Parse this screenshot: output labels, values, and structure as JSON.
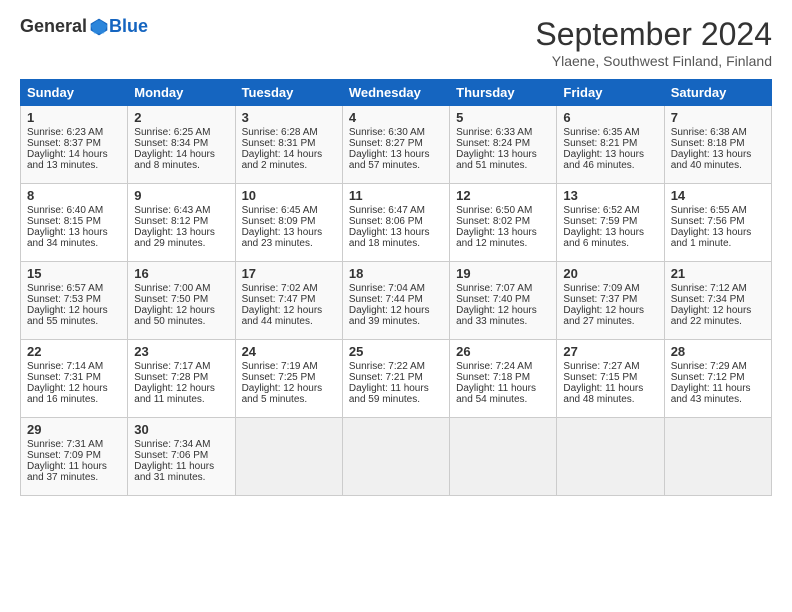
{
  "header": {
    "logo_general": "General",
    "logo_blue": "Blue",
    "title": "September 2024",
    "location": "Ylaene, Southwest Finland, Finland"
  },
  "days_of_week": [
    "Sunday",
    "Monday",
    "Tuesday",
    "Wednesday",
    "Thursday",
    "Friday",
    "Saturday"
  ],
  "weeks": [
    [
      {
        "day": "1",
        "sunrise": "Sunrise: 6:23 AM",
        "sunset": "Sunset: 8:37 PM",
        "daylight": "Daylight: 14 hours and 13 minutes."
      },
      {
        "day": "2",
        "sunrise": "Sunrise: 6:25 AM",
        "sunset": "Sunset: 8:34 PM",
        "daylight": "Daylight: 14 hours and 8 minutes."
      },
      {
        "day": "3",
        "sunrise": "Sunrise: 6:28 AM",
        "sunset": "Sunset: 8:31 PM",
        "daylight": "Daylight: 14 hours and 2 minutes."
      },
      {
        "day": "4",
        "sunrise": "Sunrise: 6:30 AM",
        "sunset": "Sunset: 8:27 PM",
        "daylight": "Daylight: 13 hours and 57 minutes."
      },
      {
        "day": "5",
        "sunrise": "Sunrise: 6:33 AM",
        "sunset": "Sunset: 8:24 PM",
        "daylight": "Daylight: 13 hours and 51 minutes."
      },
      {
        "day": "6",
        "sunrise": "Sunrise: 6:35 AM",
        "sunset": "Sunset: 8:21 PM",
        "daylight": "Daylight: 13 hours and 46 minutes."
      },
      {
        "day": "7",
        "sunrise": "Sunrise: 6:38 AM",
        "sunset": "Sunset: 8:18 PM",
        "daylight": "Daylight: 13 hours and 40 minutes."
      }
    ],
    [
      {
        "day": "8",
        "sunrise": "Sunrise: 6:40 AM",
        "sunset": "Sunset: 8:15 PM",
        "daylight": "Daylight: 13 hours and 34 minutes."
      },
      {
        "day": "9",
        "sunrise": "Sunrise: 6:43 AM",
        "sunset": "Sunset: 8:12 PM",
        "daylight": "Daylight: 13 hours and 29 minutes."
      },
      {
        "day": "10",
        "sunrise": "Sunrise: 6:45 AM",
        "sunset": "Sunset: 8:09 PM",
        "daylight": "Daylight: 13 hours and 23 minutes."
      },
      {
        "day": "11",
        "sunrise": "Sunrise: 6:47 AM",
        "sunset": "Sunset: 8:06 PM",
        "daylight": "Daylight: 13 hours and 18 minutes."
      },
      {
        "day": "12",
        "sunrise": "Sunrise: 6:50 AM",
        "sunset": "Sunset: 8:02 PM",
        "daylight": "Daylight: 13 hours and 12 minutes."
      },
      {
        "day": "13",
        "sunrise": "Sunrise: 6:52 AM",
        "sunset": "Sunset: 7:59 PM",
        "daylight": "Daylight: 13 hours and 6 minutes."
      },
      {
        "day": "14",
        "sunrise": "Sunrise: 6:55 AM",
        "sunset": "Sunset: 7:56 PM",
        "daylight": "Daylight: 13 hours and 1 minute."
      }
    ],
    [
      {
        "day": "15",
        "sunrise": "Sunrise: 6:57 AM",
        "sunset": "Sunset: 7:53 PM",
        "daylight": "Daylight: 12 hours and 55 minutes."
      },
      {
        "day": "16",
        "sunrise": "Sunrise: 7:00 AM",
        "sunset": "Sunset: 7:50 PM",
        "daylight": "Daylight: 12 hours and 50 minutes."
      },
      {
        "day": "17",
        "sunrise": "Sunrise: 7:02 AM",
        "sunset": "Sunset: 7:47 PM",
        "daylight": "Daylight: 12 hours and 44 minutes."
      },
      {
        "day": "18",
        "sunrise": "Sunrise: 7:04 AM",
        "sunset": "Sunset: 7:44 PM",
        "daylight": "Daylight: 12 hours and 39 minutes."
      },
      {
        "day": "19",
        "sunrise": "Sunrise: 7:07 AM",
        "sunset": "Sunset: 7:40 PM",
        "daylight": "Daylight: 12 hours and 33 minutes."
      },
      {
        "day": "20",
        "sunrise": "Sunrise: 7:09 AM",
        "sunset": "Sunset: 7:37 PM",
        "daylight": "Daylight: 12 hours and 27 minutes."
      },
      {
        "day": "21",
        "sunrise": "Sunrise: 7:12 AM",
        "sunset": "Sunset: 7:34 PM",
        "daylight": "Daylight: 12 hours and 22 minutes."
      }
    ],
    [
      {
        "day": "22",
        "sunrise": "Sunrise: 7:14 AM",
        "sunset": "Sunset: 7:31 PM",
        "daylight": "Daylight: 12 hours and 16 minutes."
      },
      {
        "day": "23",
        "sunrise": "Sunrise: 7:17 AM",
        "sunset": "Sunset: 7:28 PM",
        "daylight": "Daylight: 12 hours and 11 minutes."
      },
      {
        "day": "24",
        "sunrise": "Sunrise: 7:19 AM",
        "sunset": "Sunset: 7:25 PM",
        "daylight": "Daylight: 12 hours and 5 minutes."
      },
      {
        "day": "25",
        "sunrise": "Sunrise: 7:22 AM",
        "sunset": "Sunset: 7:21 PM",
        "daylight": "Daylight: 11 hours and 59 minutes."
      },
      {
        "day": "26",
        "sunrise": "Sunrise: 7:24 AM",
        "sunset": "Sunset: 7:18 PM",
        "daylight": "Daylight: 11 hours and 54 minutes."
      },
      {
        "day": "27",
        "sunrise": "Sunrise: 7:27 AM",
        "sunset": "Sunset: 7:15 PM",
        "daylight": "Daylight: 11 hours and 48 minutes."
      },
      {
        "day": "28",
        "sunrise": "Sunrise: 7:29 AM",
        "sunset": "Sunset: 7:12 PM",
        "daylight": "Daylight: 11 hours and 43 minutes."
      }
    ],
    [
      {
        "day": "29",
        "sunrise": "Sunrise: 7:31 AM",
        "sunset": "Sunset: 7:09 PM",
        "daylight": "Daylight: 11 hours and 37 minutes."
      },
      {
        "day": "30",
        "sunrise": "Sunrise: 7:34 AM",
        "sunset": "Sunset: 7:06 PM",
        "daylight": "Daylight: 11 hours and 31 minutes."
      },
      {
        "day": "",
        "sunrise": "",
        "sunset": "",
        "daylight": ""
      },
      {
        "day": "",
        "sunrise": "",
        "sunset": "",
        "daylight": ""
      },
      {
        "day": "",
        "sunrise": "",
        "sunset": "",
        "daylight": ""
      },
      {
        "day": "",
        "sunrise": "",
        "sunset": "",
        "daylight": ""
      },
      {
        "day": "",
        "sunrise": "",
        "sunset": "",
        "daylight": ""
      }
    ]
  ]
}
